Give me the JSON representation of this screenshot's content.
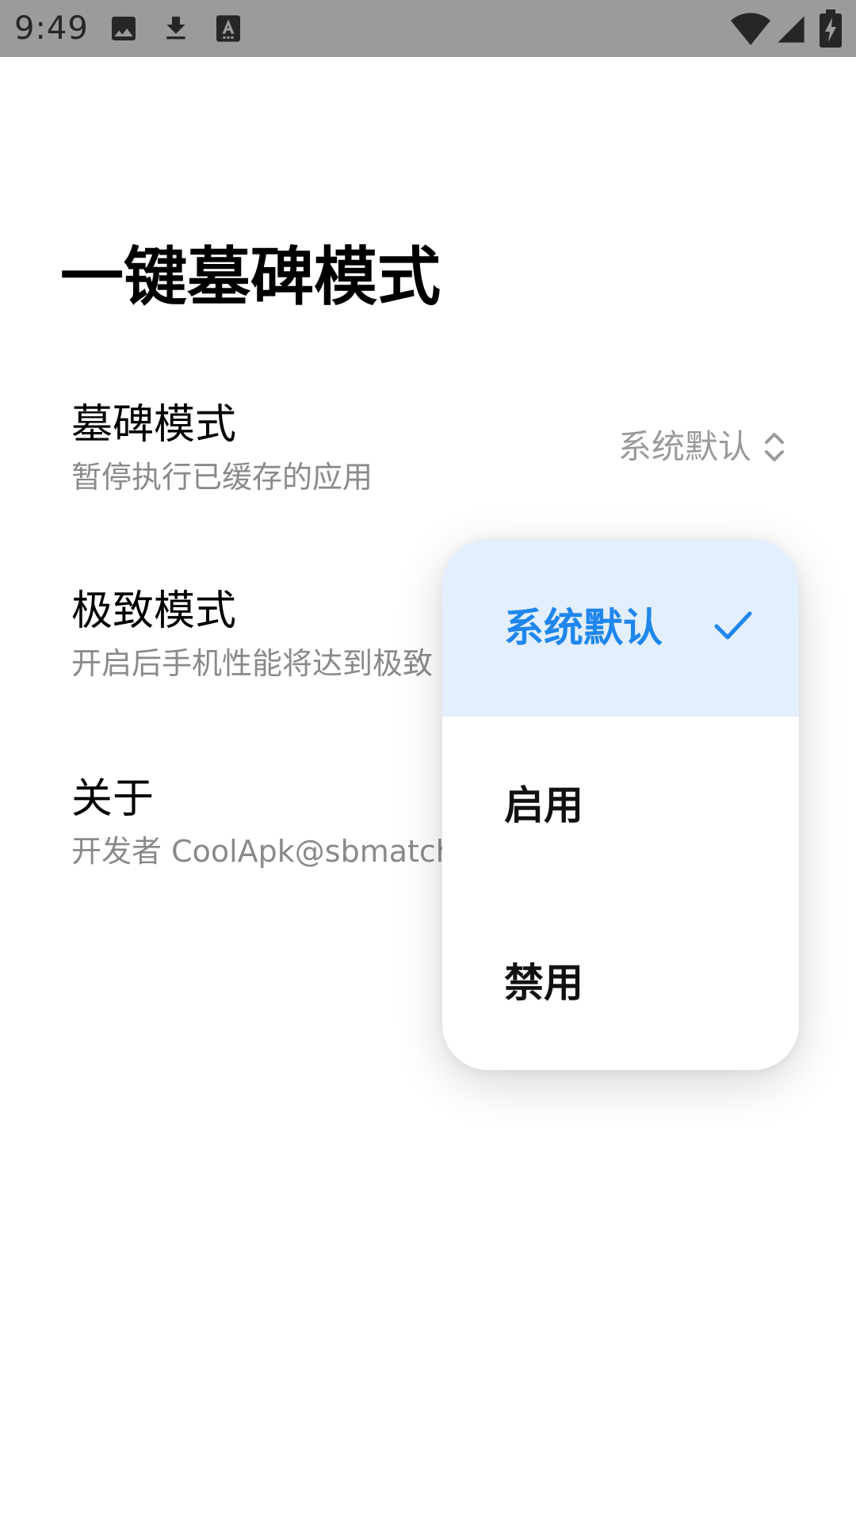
{
  "status_bar": {
    "time": "9:49",
    "icons_left": [
      "image-icon",
      "download-icon",
      "a-font-icon"
    ],
    "icons_right": [
      "wifi-icon",
      "signal-icon",
      "battery-charging-icon"
    ],
    "background": "#9b9b9b"
  },
  "page": {
    "title": "一键墓碑模式"
  },
  "settings": [
    {
      "title": "墓碑模式",
      "subtitle": "暂停执行已缓存的应用",
      "value": "系统默认"
    },
    {
      "title": "极致模式",
      "subtitle": "开启后手机性能将达到极致"
    },
    {
      "title": "关于",
      "subtitle": "开发者 CoolApk@sbmatch"
    }
  ],
  "dropdown": {
    "options": [
      {
        "label": "系统默认",
        "selected": true
      },
      {
        "label": "启用",
        "selected": false
      },
      {
        "label": "禁用",
        "selected": false
      }
    ],
    "accent": "#1f86ee",
    "selected_bg": "#e3effc"
  }
}
